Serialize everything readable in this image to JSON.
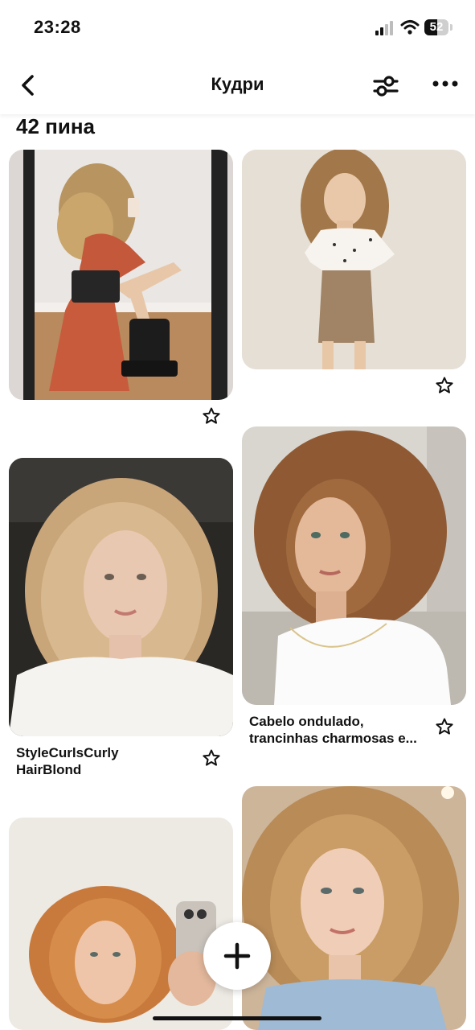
{
  "status_bar": {
    "time": "23:28",
    "battery": "52",
    "battery_level": 0.52
  },
  "header": {
    "title": "Кудри",
    "back_icon": "chevron-left-icon",
    "filter_icon": "sliders-icon",
    "more_icon": "more-horizontal-icon"
  },
  "board": {
    "pin_count": "42 пина"
  },
  "pins": [
    {
      "caption": "",
      "description": "Woman with curly hair taking mirror selfie in boots"
    },
    {
      "caption": "",
      "description": "Woman with curly hair in floral top and skirt"
    },
    {
      "caption_line1": "StyleCurlsCurly",
      "caption_line2": "HairBlond"
    },
    {
      "caption_line1": "Cabelo ondulado,",
      "caption_line2": "trancinhas charmosas e..."
    },
    {
      "caption": ""
    },
    {
      "caption": ""
    }
  ],
  "fab": {
    "icon": "plus-icon"
  },
  "colors": {
    "accent": "#111111",
    "background": "#ffffff"
  }
}
